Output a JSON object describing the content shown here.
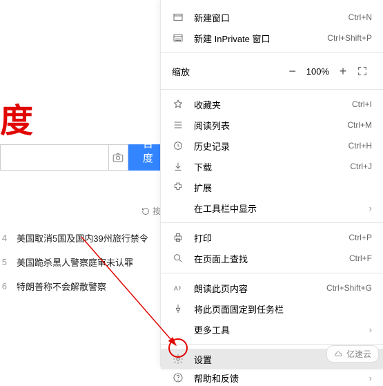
{
  "logo_text": "度",
  "search": {
    "placeholder": "",
    "button": "百度一"
  },
  "refresh_label": "按",
  "news": [
    {
      "idx": "4",
      "text": "美国取消5国及国内39州旅行禁令"
    },
    {
      "idx": "5",
      "text": "美国跪杀黑人警察庭审未认罪"
    },
    {
      "idx": "6",
      "text": "特朗普称不会解散警察"
    }
  ],
  "menu": {
    "new_window": "新建窗口",
    "sc_new_window": "Ctrl+N",
    "new_inprivate": "新建 InPrivate 窗口",
    "sc_new_inprivate": "Ctrl+Shift+P",
    "zoom_label": "缩放",
    "zoom_value": "100%",
    "favorites": "收藏夹",
    "sc_favorites": "Ctrl+I",
    "reading_list": "阅读列表",
    "sc_reading": "Ctrl+M",
    "history": "历史记录",
    "sc_history": "Ctrl+H",
    "downloads": "下载",
    "sc_downloads": "Ctrl+J",
    "extensions": "扩展",
    "show_in_toolbar": "在工具栏中显示",
    "print": "打印",
    "sc_print": "Ctrl+P",
    "find": "在页面上查找",
    "sc_find": "Ctrl+F",
    "read_aloud": "朗读此页内容",
    "sc_read": "Ctrl+Shift+G",
    "pin_taskbar": "将此页面固定到任务栏",
    "more_tools": "更多工具",
    "settings": "设置",
    "help": "帮助和反馈"
  },
  "watermark": "亿速云"
}
